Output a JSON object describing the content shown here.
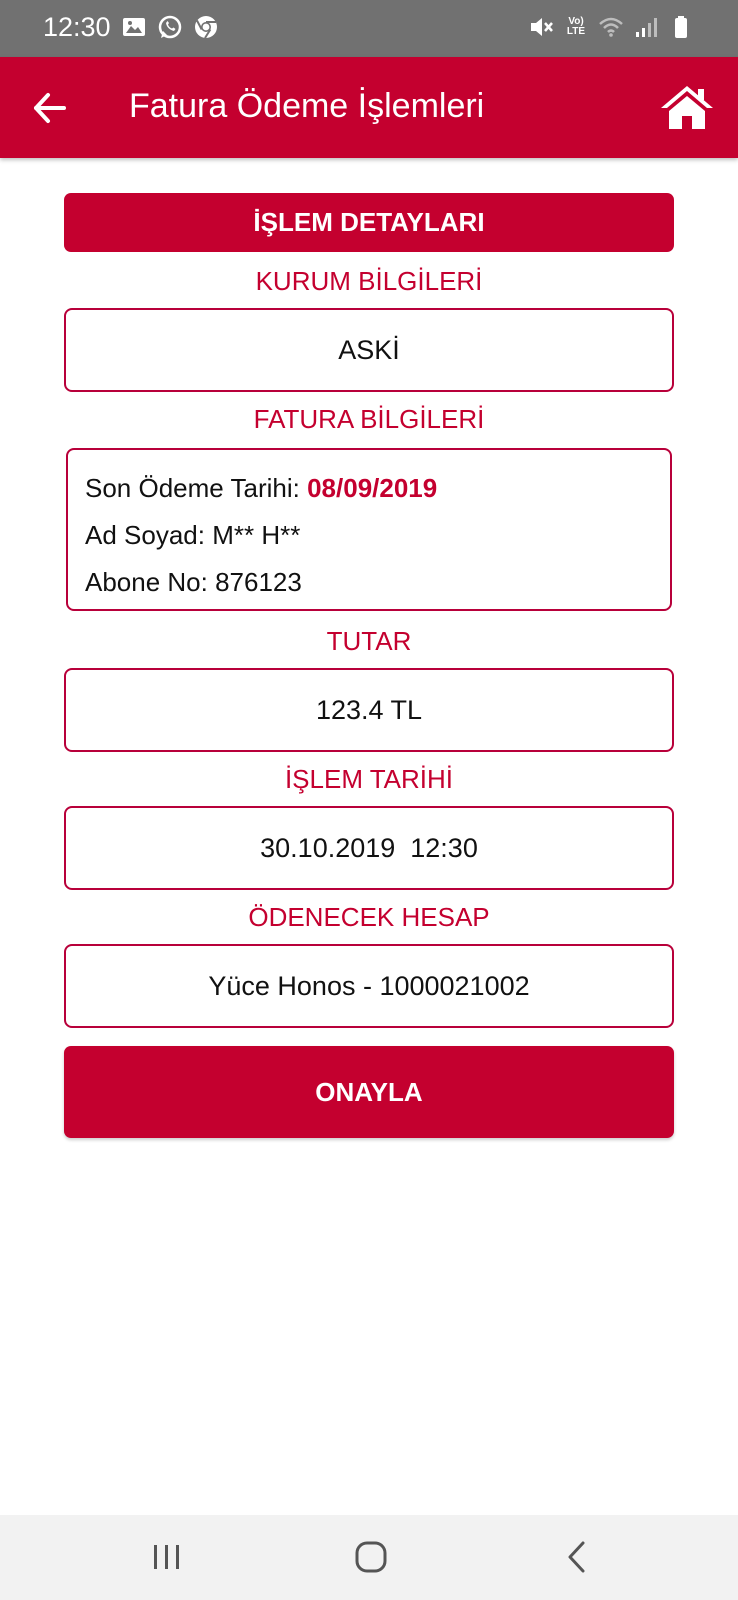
{
  "status_bar": {
    "time": "12:30",
    "left_icons": [
      "image-icon",
      "whatsapp-icon",
      "chrome-icon"
    ],
    "right_icons": [
      "mute-icon",
      "volte-icon",
      "wifi-icon",
      "signal-icon",
      "battery-icon"
    ],
    "volte_text": "Vo) LTE"
  },
  "app_bar": {
    "title": "Fatura Ödeme İşlemleri",
    "back_icon": "arrow-left-icon",
    "home_icon": "home-icon"
  },
  "main": {
    "section_title": "İŞLEM DETAYLARI",
    "kurum": {
      "label": "KURUM BİLGİLERİ",
      "value": "ASKİ"
    },
    "fatura": {
      "label": "FATURA BİLGİLERİ",
      "due_date_label": "Son Ödeme Tarihi: ",
      "due_date_value": "08/09/2019",
      "name_line": "Ad Soyad: M** H**",
      "subscriber_line": "Abone No: 876123"
    },
    "tutar": {
      "label": "TUTAR",
      "value": "123.4 TL"
    },
    "islem_tarihi": {
      "label": "İŞLEM TARİHİ",
      "value": "30.10.2019  12:30"
    },
    "hesap": {
      "label": "ÖDENECEK HESAP",
      "value": "Yüce Honos - 1000021002"
    },
    "confirm_label": "ONAYLA"
  },
  "nav_bar": {
    "icons": [
      "recent-apps-icon",
      "home-circle-icon",
      "back-chevron-icon"
    ]
  },
  "colors": {
    "accent": "#c4002f",
    "status_bar": "#717171",
    "nav_bar": "#f2f2f2"
  }
}
